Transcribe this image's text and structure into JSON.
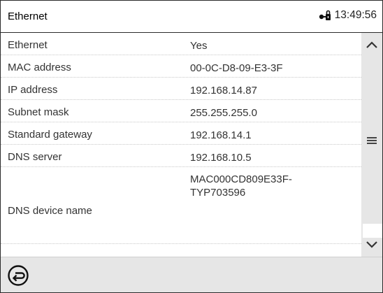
{
  "header": {
    "title": "Ethernet",
    "time": "13:49:56",
    "icons": [
      "lock-key-icon"
    ]
  },
  "rows": [
    {
      "label": "Ethernet",
      "value": "Yes"
    },
    {
      "label": "MAC address",
      "value": "00-0C-D8-09-E3-3F"
    },
    {
      "label": "IP address",
      "value": "192.168.14.87"
    },
    {
      "label": "Subnet mask",
      "value": "255.255.255.0"
    },
    {
      "label": "Standard gateway",
      "value": "192.168.14.1"
    },
    {
      "label": "DNS server",
      "value": "192.168.10.5"
    },
    {
      "label": "DNS device name",
      "value_line1": "MAC000CD809E33F-",
      "value_line2": "TYP703596"
    }
  ],
  "scrollbar": {
    "up_icon": "chevron-up-icon",
    "menu_icon": "hamburger-icon",
    "down_icon": "chevron-down-icon"
  },
  "footer": {
    "back_icon": "back-arrow-icon"
  },
  "colors": {
    "background": "#ffffff",
    "scrollbar": "#e6e6e6",
    "footer": "#e6e6e6",
    "border": "#2b2b2b",
    "text": "#333333"
  }
}
